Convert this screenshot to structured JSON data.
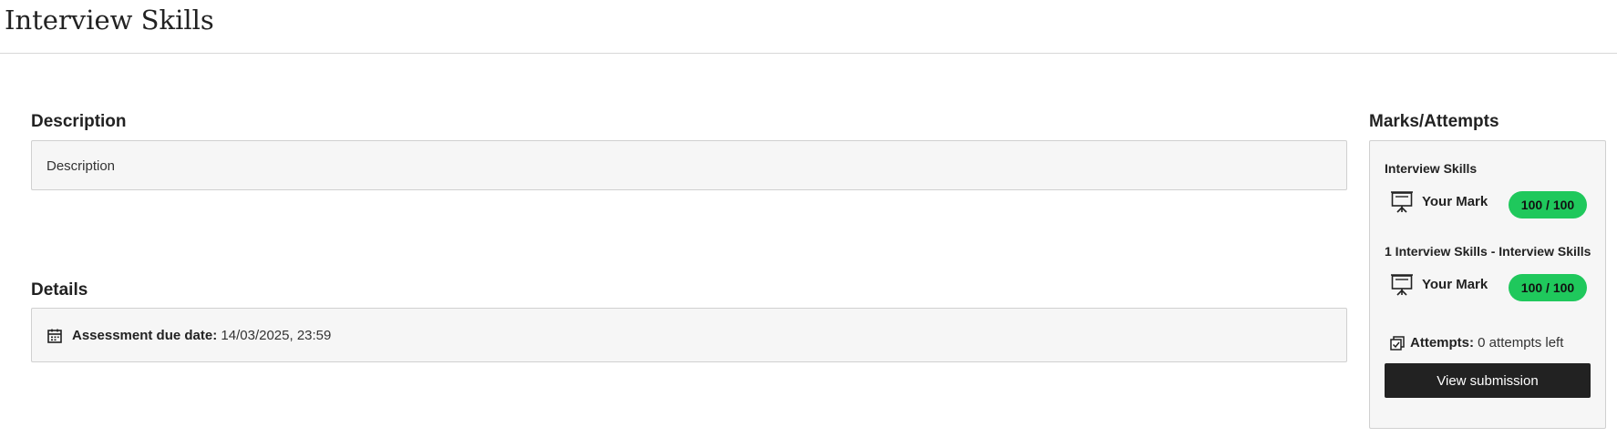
{
  "page": {
    "title": "Interview Skills"
  },
  "description": {
    "heading": "Description",
    "text": "Description"
  },
  "details": {
    "heading": "Details",
    "due_label": "Assessment due date:",
    "due_value": "14/03/2025, 23:59",
    "icon": "calendar-icon"
  },
  "marks": {
    "heading": "Marks/Attempts",
    "items": [
      {
        "title": "Interview Skills",
        "mark_label": "Your Mark",
        "mark_value": "100 / 100",
        "icon": "presentation-board-icon"
      },
      {
        "title": "1 Interview Skills - Interview Skills",
        "mark_label": "Your Mark",
        "mark_value": "100 / 100",
        "icon": "presentation-board-icon"
      }
    ],
    "attempts_label": "Attempts:",
    "attempts_value": "0 attempts left",
    "attempts_icon": "attempts-icon",
    "view_button_label": "View submission"
  },
  "colors": {
    "badge": "#1fc85c",
    "button": "#222222",
    "panel_bg": "#f6f6f6"
  }
}
